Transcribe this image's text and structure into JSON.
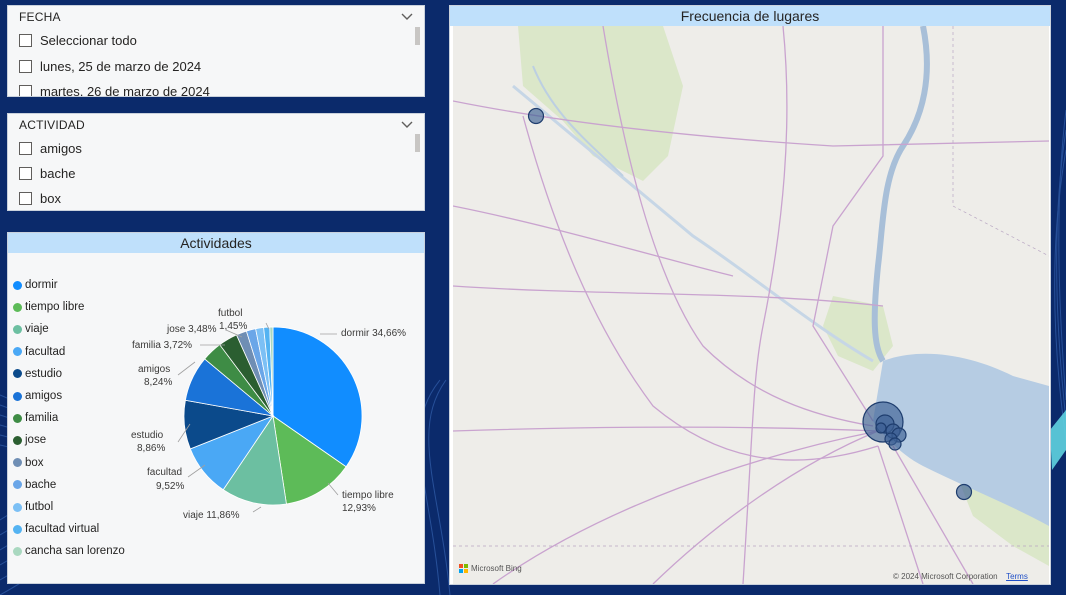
{
  "slicer_fecha": {
    "title": "FECHA",
    "items": [
      "Seleccionar todo",
      "lunes, 25 de marzo de 2024",
      "martes, 26 de marzo de 2024"
    ]
  },
  "slicer_actividad": {
    "title": "ACTIVIDAD",
    "items": [
      "amigos",
      "bache",
      "box"
    ]
  },
  "pie": {
    "title": "Actividades",
    "legend": [
      {
        "label": "dormir",
        "color": "#118dff"
      },
      {
        "label": "tiempo libre",
        "color": "#5dbb58"
      },
      {
        "label": "viaje",
        "color": "#6cbfa1"
      },
      {
        "label": "facultad",
        "color": "#4aa8f5"
      },
      {
        "label": "estudio",
        "color": "#0b4a8b"
      },
      {
        "label": "amigos",
        "color": "#1a73d8"
      },
      {
        "label": "familia",
        "color": "#3e8c45"
      },
      {
        "label": "jose",
        "color": "#2b5e31"
      },
      {
        "label": "box",
        "color": "#6f8eb4"
      },
      {
        "label": "bache",
        "color": "#6aa6e8"
      },
      {
        "label": "futbol",
        "color": "#7cc0f5"
      },
      {
        "label": "facultad virtual",
        "color": "#54b3f2"
      },
      {
        "label": "cancha san lorenzo",
        "color": "#a9d8c0"
      }
    ],
    "labels": {
      "dormir": "dormir 34,66%",
      "tiempo_libre_1": "tiempo libre",
      "tiempo_libre_2": "12,93%",
      "viaje": "viaje 11,86%",
      "facultad_1": "facultad",
      "facultad_2": "9,52%",
      "estudio_1": "estudio",
      "estudio_2": "8,86%",
      "amigos_1": "amigos",
      "amigos_2": "8,24%",
      "familia": "familia 3,72%",
      "jose": "jose 3,48%",
      "futbol_1": "futbol",
      "futbol_2": "1,45%"
    }
  },
  "chart_data": {
    "type": "pie",
    "title": "Actividades",
    "categories": [
      "dormir",
      "tiempo libre",
      "viaje",
      "facultad",
      "estudio",
      "amigos",
      "familia",
      "jose",
      "box",
      "bache",
      "futbol",
      "facultad virtual",
      "cancha san lorenzo"
    ],
    "values": [
      34.66,
      12.93,
      11.86,
      9.52,
      8.86,
      8.24,
      3.72,
      3.48,
      1.9,
      1.7,
      1.45,
      1.1,
      0.58
    ],
    "colors": [
      "#118dff",
      "#5dbb58",
      "#6cbfa1",
      "#4aa8f5",
      "#0b4a8b",
      "#1a73d8",
      "#3e8c45",
      "#2b5e31",
      "#6f8eb4",
      "#6aa6e8",
      "#7cc0f5",
      "#54b3f2",
      "#a9d8c0"
    ],
    "legend": "left"
  },
  "map": {
    "title": "Frecuencia de lugares",
    "brand": "Microsoft Bing",
    "copyright": "© 2024 Microsoft Corporation",
    "terms": "Terms"
  }
}
